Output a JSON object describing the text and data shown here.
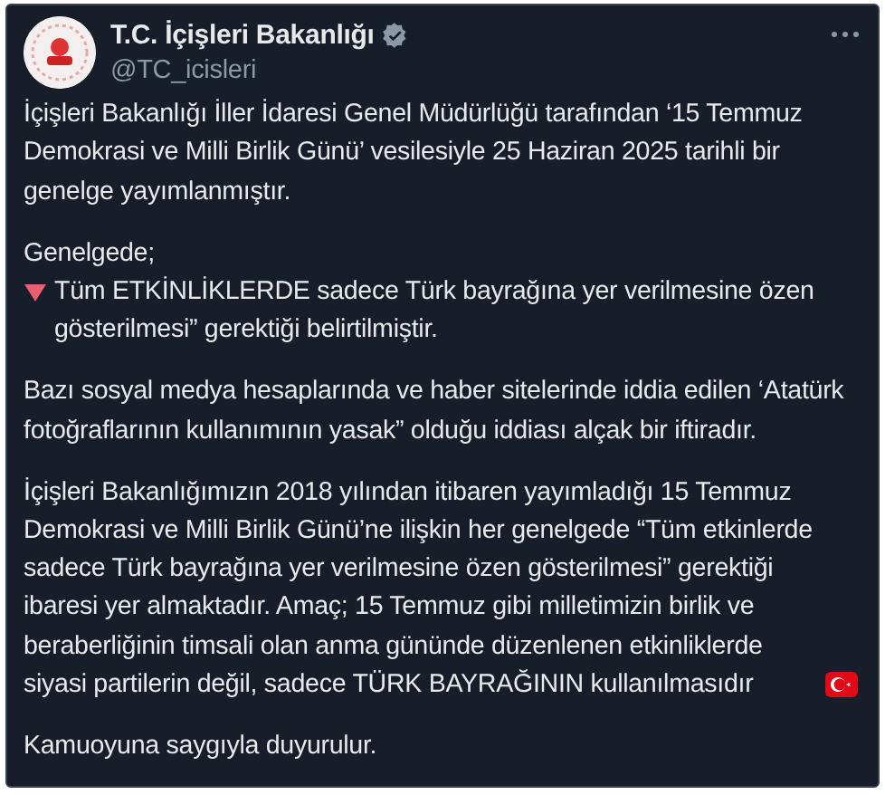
{
  "post": {
    "author": {
      "name": "T.C. İçişleri Bakanlığı",
      "handle": "@TC_icisleri",
      "verified": true
    },
    "paragraphs": [
      {
        "blocks": [
          {
            "kind": "plain",
            "text": "İçişleri Bakanlığı İller İdaresi Genel Müdürlüğü tarafından ‘15 Temmuz Demokrasi ve Milli Birlik Günü’ vesilesiyle 25 Haziran 2025 tarihli bir genelge yayımlanmıştır."
          }
        ]
      },
      {
        "blocks": [
          {
            "kind": "plain",
            "text": "Genelgede;"
          },
          {
            "kind": "triangle_bullet",
            "text": "Tüm ETKİNLİKLERDE sadece Türk bayrağına yer verilmesine özen gösterilmesi” gerektiği belirtilmiştir."
          }
        ]
      },
      {
        "blocks": [
          {
            "kind": "plain",
            "text": "Bazı sosyal medya hesaplarında ve haber sitelerinde iddia edilen ‘Atatürk fotoğraflarının kullanımının yasak” olduğu iddiası alçak bir iftiradır."
          }
        ]
      },
      {
        "blocks": [
          {
            "kind": "flag_end",
            "text": "İçişleri Bakanlığımızın 2018 yılından itibaren yayımladığı 15 Temmuz Demokrasi ve Milli Birlik Günü’ne ilişkin her genelgede “Tüm etkinlerde sadece Türk bayrağına yer verilmesine özen gösterilmesi” gerektiği ibaresi yer almaktadır. Amaç; 15 Temmuz gibi milletimizin birlik ve beraberliğinin timsali olan anma gününde düzenlenen etkinliklerde siyasi partilerin değil, sadece TÜRK BAYRAĞININ kullanılmasıdır"
          }
        ]
      },
      {
        "blocks": [
          {
            "kind": "plain",
            "text": "Kamuoyuna saygıyla duyurulur."
          }
        ]
      }
    ]
  }
}
